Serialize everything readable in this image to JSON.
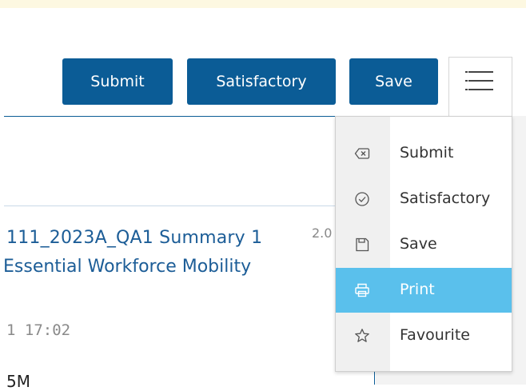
{
  "toolbar": {
    "submit_label": "Submit",
    "satisfactory_label": "Satisfactory",
    "save_label": "Save",
    "menu_icon": "hamburger-menu-icon"
  },
  "content": {
    "title_line1": "111_2023A_QA1 Summary 1",
    "title_line2": "Essential Workforce Mobility",
    "version": "2.0",
    "time": "1 17:02",
    "size": "5M"
  },
  "menu": {
    "items": [
      {
        "label": "Submit",
        "icon": "backspace-icon"
      },
      {
        "label": "Satisfactory",
        "icon": "check-circle-icon"
      },
      {
        "label": "Save",
        "icon": "save-icon"
      },
      {
        "label": "Print",
        "icon": "print-icon",
        "active": true
      },
      {
        "label": "Favourite",
        "icon": "star-icon"
      }
    ],
    "active_color": "#5ac0ec"
  },
  "colors": {
    "primary": "#0b5c96",
    "link": "#1c5d97"
  }
}
